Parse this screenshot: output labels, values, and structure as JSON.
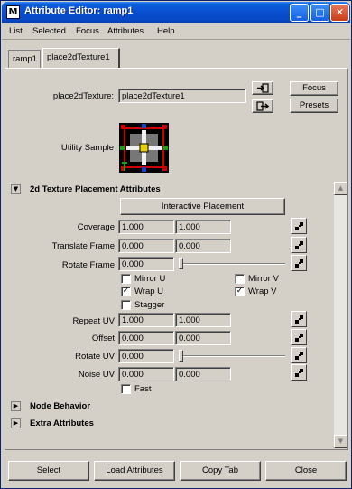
{
  "window": {
    "title": "Attribute Editor: ramp1",
    "minimize": "_",
    "maximize": "□",
    "close": "✕"
  },
  "menu": [
    "List",
    "Selected",
    "Focus",
    "Attributes",
    "Help"
  ],
  "tabs": [
    "ramp1",
    "place2dTexture1"
  ],
  "node": {
    "label": "place2dTexture:",
    "value": "place2dTexture1",
    "focus": "Focus",
    "presets": "Presets",
    "utility_label": "Utility Sample"
  },
  "section": {
    "title": "2d Texture Placement Attributes",
    "interactive": "Interactive Placement",
    "coverage": {
      "label": "Coverage",
      "u": "1.000",
      "v": "1.000"
    },
    "translate": {
      "label": "Translate Frame",
      "u": "0.000",
      "v": "0.000"
    },
    "rotate_frame": {
      "label": "Rotate Frame",
      "value": "0.000"
    },
    "mirror_u": "Mirror U",
    "mirror_v": "Mirror V",
    "wrap_u": "Wrap U",
    "wrap_v": "Wrap V",
    "stagger": "Stagger",
    "repeat": {
      "label": "Repeat UV",
      "u": "1.000",
      "v": "1.000"
    },
    "offset": {
      "label": "Offset",
      "u": "0.000",
      "v": "0.000"
    },
    "rotate_uv": {
      "label": "Rotate UV",
      "value": "0.000"
    },
    "noise": {
      "label": "Noise UV",
      "u": "0.000",
      "v": "0.000"
    },
    "fast": "Fast"
  },
  "collapsed": [
    "Node Behavior",
    "Extra Attributes"
  ],
  "buttons": [
    "Select",
    "Load Attributes",
    "Copy Tab",
    "Close"
  ]
}
